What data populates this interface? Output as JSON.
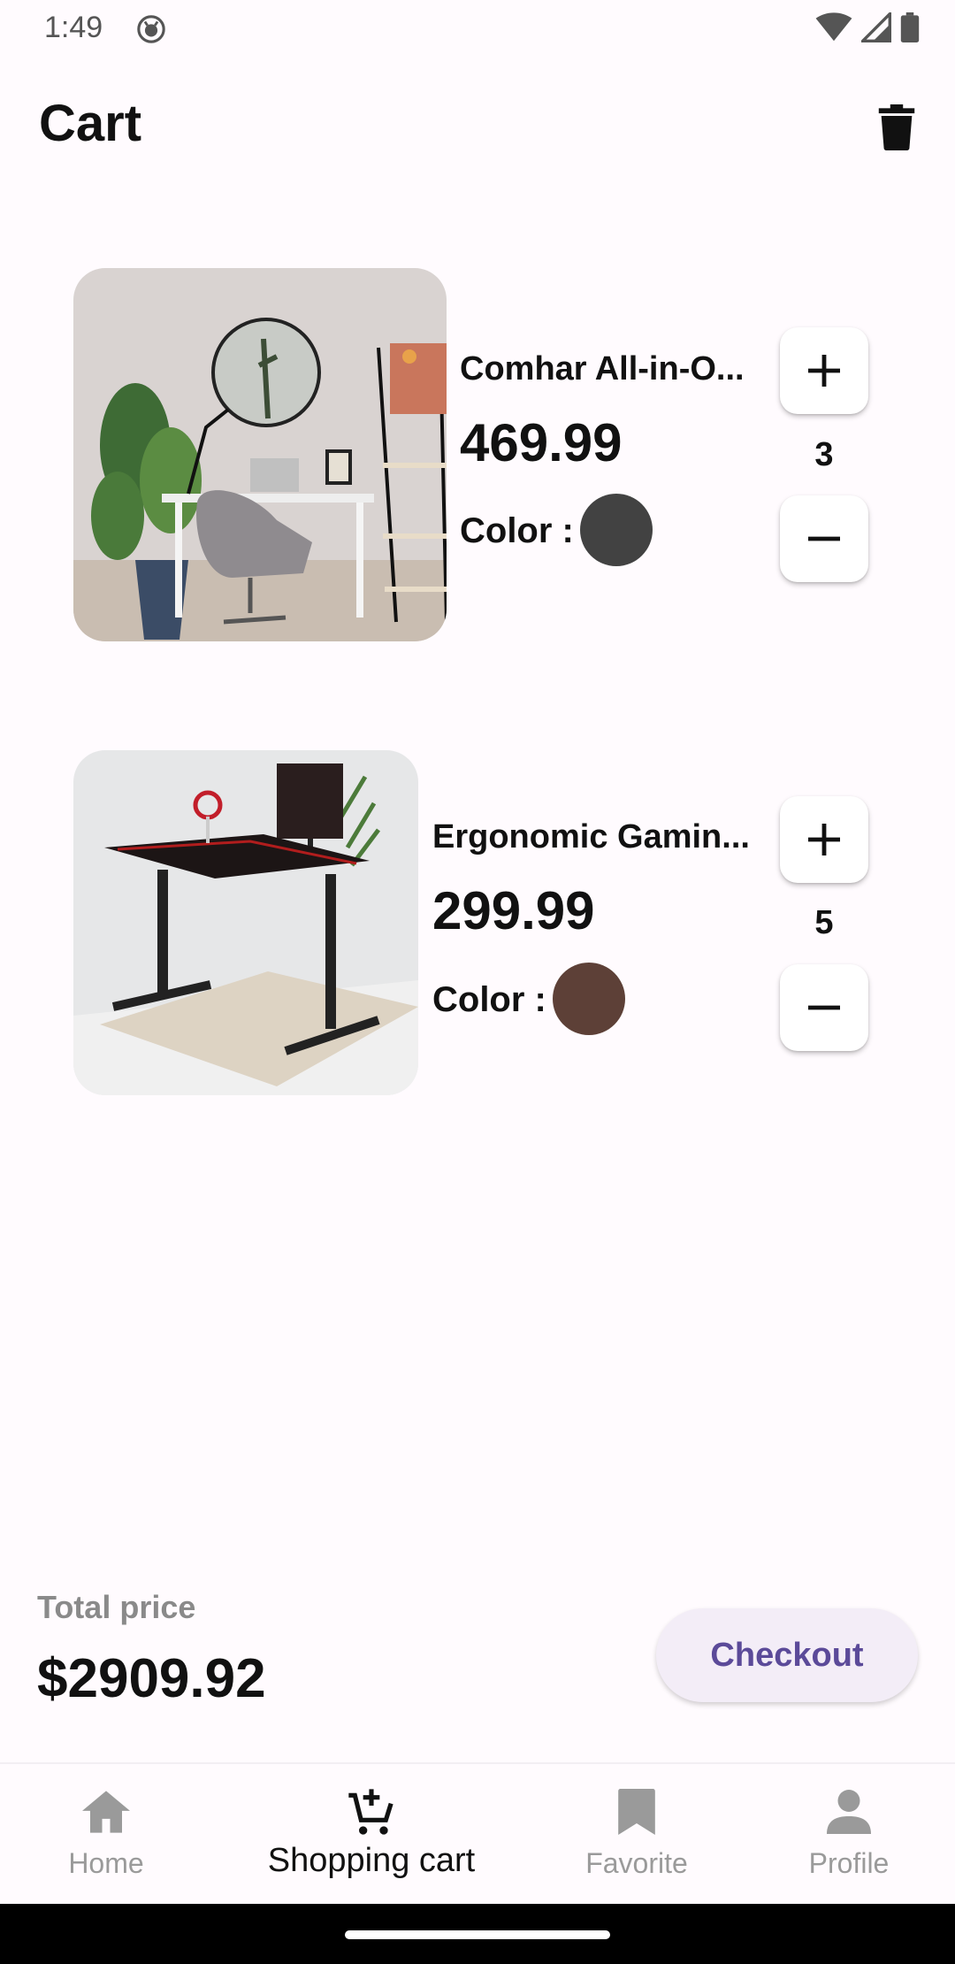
{
  "status_bar": {
    "time": "1:49"
  },
  "header": {
    "title": "Cart"
  },
  "cart_items": [
    {
      "name": "Comhar All-in-O...",
      "price": "469.99",
      "color_label": "Color :",
      "color": "#424242",
      "quantity": "3"
    },
    {
      "name": "Ergonomic Gamin...",
      "price": "299.99",
      "color_label": "Color :",
      "color": "#5d4037",
      "quantity": "5"
    }
  ],
  "footer": {
    "total_label": "Total price",
    "total_value": "$2909.92",
    "checkout_label": "Checkout"
  },
  "bottom_nav": [
    {
      "label": "Home",
      "icon": "home-icon",
      "active": false
    },
    {
      "label": "Shopping cart",
      "icon": "cart-add-icon",
      "active": true
    },
    {
      "label": "Favorite",
      "icon": "bookmark-icon",
      "active": false
    },
    {
      "label": "Profile",
      "icon": "person-icon",
      "active": false
    }
  ],
  "colors": {
    "accent": "#5b4a99",
    "checkout_bg": "#f3edf7",
    "background": "#fffbfe"
  }
}
